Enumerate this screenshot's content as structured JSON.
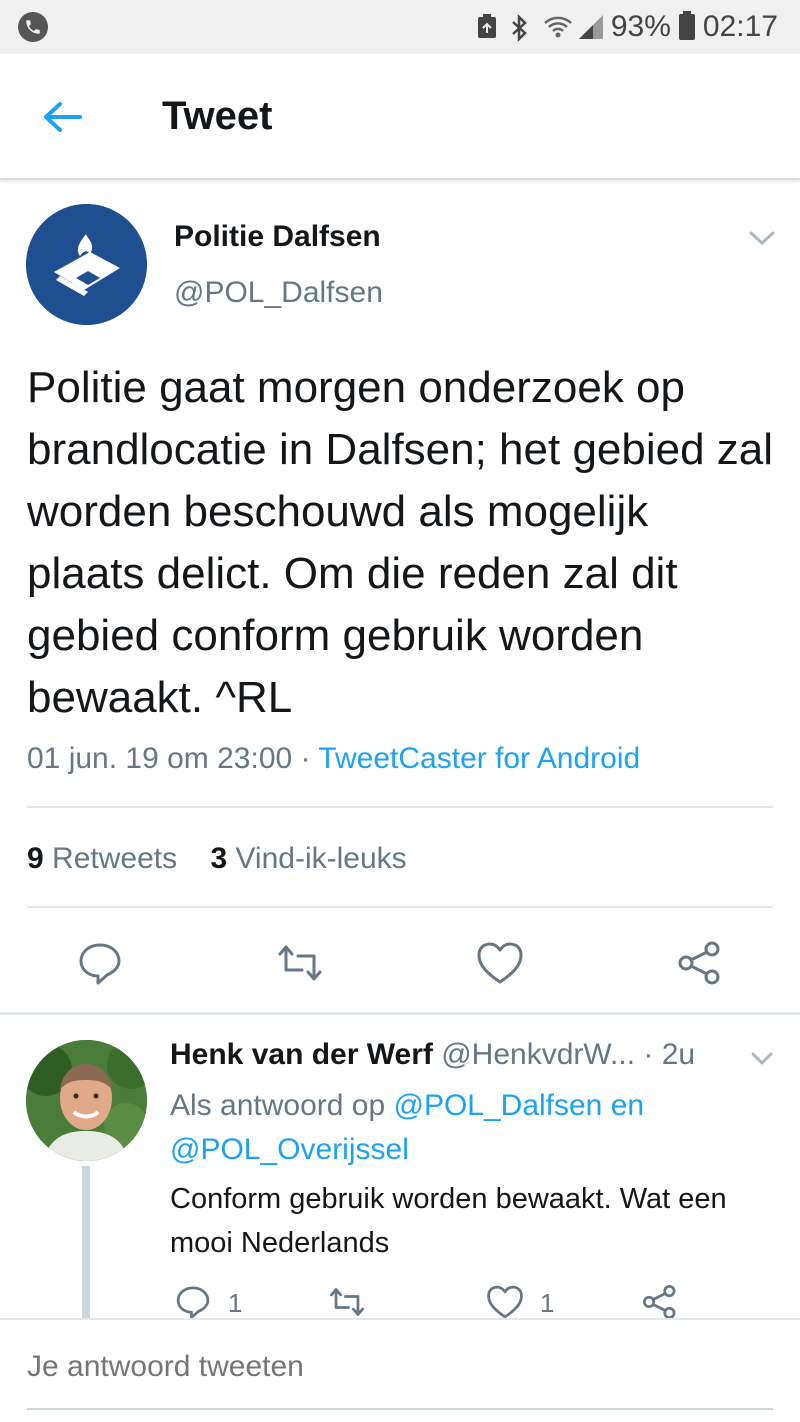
{
  "status_bar": {
    "battery": "93%",
    "time": "02:17",
    "icons": [
      "phone-call-icon",
      "battery-saver-icon",
      "bluetooth-icon",
      "wifi-icon",
      "signal-icon",
      "battery-icon"
    ]
  },
  "header": {
    "title": "Tweet",
    "back_icon": "arrow-left-icon"
  },
  "tweet": {
    "author_name": "Politie Dalfsen",
    "author_handle": "@POL_Dalfsen",
    "text": "Politie gaat morgen onderzoek op brandlocatie in Dalfsen; het gebied zal worden beschouwd als mogelijk plaats delict. Om die reden zal dit gebied conform gebruik worden bewaakt. ^RL",
    "timestamp": "01 jun. 19 om 23:00",
    "separator": "·",
    "source": "TweetCaster for Android",
    "retweets_count": "9",
    "retweets_label": "Retweets",
    "likes_count": "3",
    "likes_label": "Vind-ik-leuks",
    "brand_color": "#1d4f91",
    "accent_color": "#1da1f2"
  },
  "reply": {
    "author_name": "Henk van der Werf",
    "author_handle": "@HenkvdrW...",
    "time": "· 2u",
    "reply_to_prefix": "Als antwoord op",
    "mention_1": "@POL_Dalfsen",
    "and_word": "en",
    "mention_2": "@POL_Overijssel",
    "text": "Conform gebruik worden bewaakt. Wat een mooi Nederlands",
    "reply_count": "1",
    "like_count": "1"
  },
  "compose": {
    "placeholder": "Je antwoord tweeten"
  }
}
